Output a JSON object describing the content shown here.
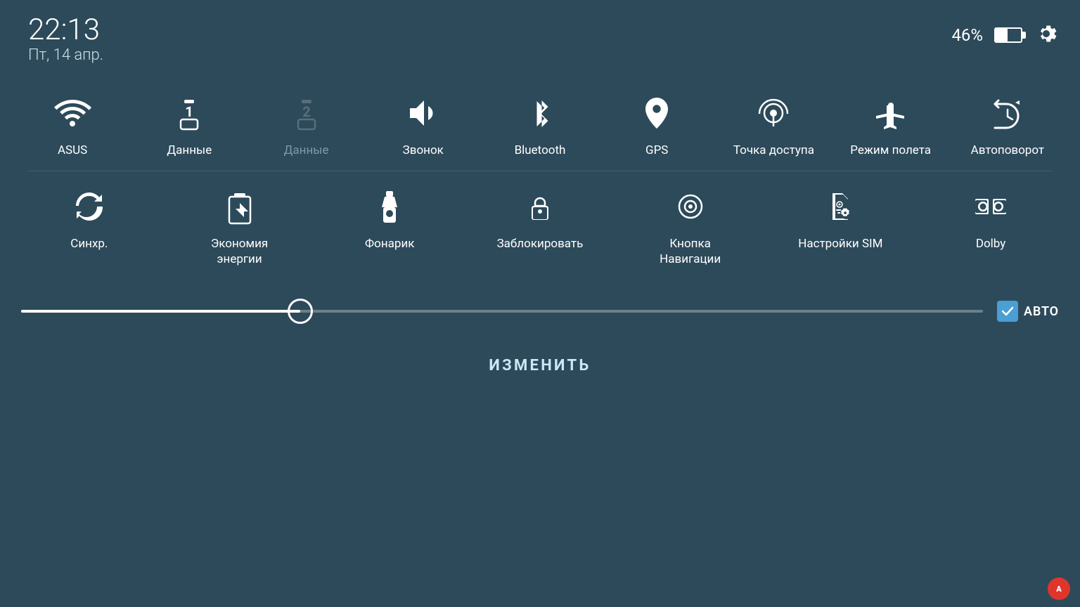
{
  "header": {
    "time": "22:13",
    "date": "Пт, 14 апр.",
    "battery_pct": "46%",
    "settings_label": "settings"
  },
  "toggles_row1": [
    {
      "id": "wifi",
      "label": "ASUS",
      "state": "active"
    },
    {
      "id": "data1",
      "label": "Данные",
      "state": "active"
    },
    {
      "id": "data2",
      "label": "Данные",
      "state": "inactive"
    },
    {
      "id": "sound",
      "label": "Звонок",
      "state": "active"
    },
    {
      "id": "bluetooth",
      "label": "Bluetooth",
      "state": "active"
    },
    {
      "id": "gps",
      "label": "GPS",
      "state": "active"
    },
    {
      "id": "hotspot",
      "label": "Точка доступа",
      "state": "active"
    },
    {
      "id": "airplane",
      "label": "Режим полета",
      "state": "active"
    },
    {
      "id": "rotate",
      "label": "Автоповорот",
      "state": "active"
    }
  ],
  "toggles_row2": [
    {
      "id": "sync",
      "label": "Синхр.",
      "state": "active"
    },
    {
      "id": "battery_saver",
      "label": "Экономия энергии",
      "state": "active"
    },
    {
      "id": "flashlight",
      "label": "Фонарик",
      "state": "active"
    },
    {
      "id": "lock_screen",
      "label": "Заблокировать",
      "state": "active"
    },
    {
      "id": "nav_button",
      "label": "Кнопка Навигации",
      "state": "active"
    },
    {
      "id": "sim_settings",
      "label": "Настройки SIM",
      "state": "active"
    },
    {
      "id": "dolby",
      "label": "Dolby",
      "state": "active"
    }
  ],
  "brightness": {
    "auto_label": "АВТО",
    "value": 29
  },
  "change_button": "ИЗМЕНИТЬ",
  "colors": {
    "background": "#2d4a5a",
    "active_icon": "#ffffff",
    "inactive_icon": "#6a8a9a",
    "label_active": "#ffffff",
    "label_inactive": "#7a9aaa"
  }
}
